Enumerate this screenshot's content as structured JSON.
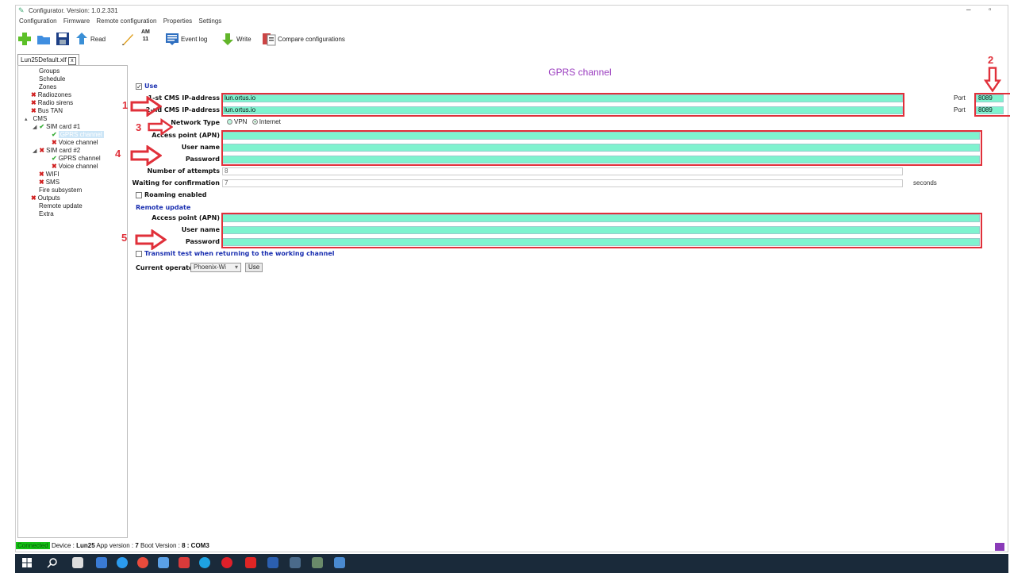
{
  "window": {
    "title": "Configurator. Version: 1.0.2.331",
    "minimize": "–",
    "restore": "▫"
  },
  "menu": [
    "Configuration",
    "Firmware",
    "Remote configuration",
    "Properties",
    "Settings"
  ],
  "toolbar": {
    "read": "Read",
    "clock_top": "AM",
    "clock_bottom": "11",
    "event_log": "Event log",
    "write": "Write",
    "compare": "Compare configurations"
  },
  "tab": {
    "label": "Lun25Default.xlf",
    "close": "x"
  },
  "tree": {
    "groups": "Groups",
    "schedule": "Schedule",
    "zones": "Zones",
    "radiozones": "Radiozones",
    "radio_sirens": "Radio sirens",
    "bus_tan": "Bus TAN",
    "cms": "CMS",
    "sim1": "SIM card #1",
    "sim1_gprs": "GPRS channel",
    "sim1_voice": "Voice channel",
    "sim2": "SIM card #2",
    "sim2_gprs": "GPRS channel",
    "sim2_voice": "Voice channel",
    "wifi": "WIFI",
    "sms": "SMS",
    "fire": "Fire subsystem",
    "outputs": "Outputs",
    "remote_update": "Remote update",
    "extra": "Extra"
  },
  "form": {
    "heading": "GPRS channel",
    "use_label": "Use",
    "use_mark": "✓",
    "cms1_label": "1-st CMS IP-address",
    "cms1_value": "lun.ortus.io",
    "cms2_label": "2-nd CMS IP-address",
    "cms2_value": "lun.ortus.io",
    "port_label": "Port",
    "port1_value": "8089",
    "port2_value": "8089",
    "network_type_label": "Network Type",
    "vpn_label": "VPN",
    "internet_label": "Internet",
    "apn_label": "Access point (APN)",
    "user_label": "User name",
    "password_label": "Password",
    "attempts_label": "Number of attempts",
    "attempts_value": "8",
    "waiting_label": "Waiting for confirmation",
    "waiting_value": "7",
    "seconds_label": "seconds",
    "roaming_label": "Roaming enabled",
    "remote_update_label": "Remote update",
    "ru_apn_label": "Access point (APN)",
    "ru_user_label": "User name",
    "ru_password_label": "Password",
    "transmit_label": "Transmit test when returning to the working channel",
    "operator_label": "Current operator",
    "operator_value": "Phoenix-Wi",
    "operator_caret": "▾",
    "use_button": "Use"
  },
  "annotations": {
    "n1": "1",
    "n2": "2",
    "n3": "3",
    "n4": "4",
    "n5": "5"
  },
  "status": {
    "connected": "Connected",
    "device_label": "Device :",
    "device_value": "Lun25",
    "app_label": "App version :",
    "app_value": "7",
    "boot_label": "Boot Version :",
    "boot_value": "8",
    "port": ": COM3"
  },
  "colors": {
    "field": "#7ff3cf",
    "annotation": "#e0303a",
    "heading": "#9a3cbf",
    "section_blue": "#1a2fb0"
  }
}
